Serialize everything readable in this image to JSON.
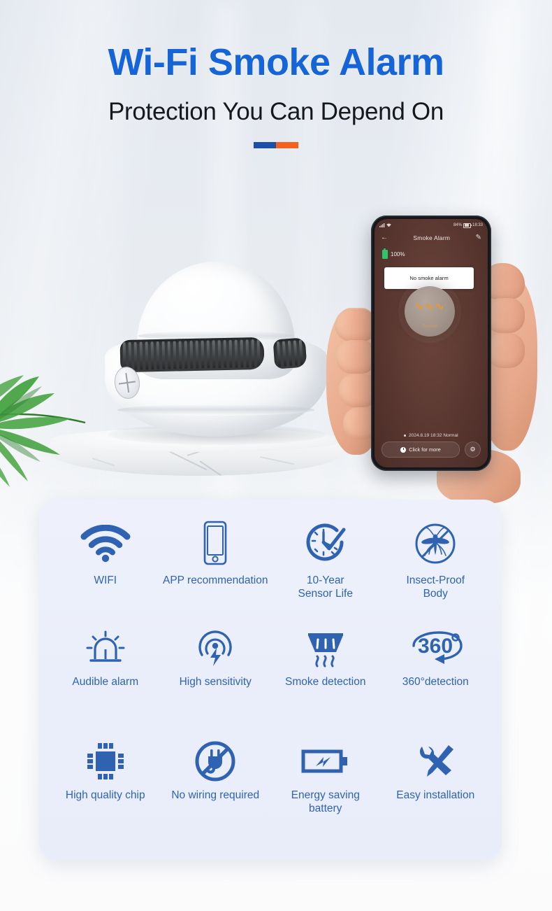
{
  "header": {
    "title": "Wi-Fi Smoke Alarm",
    "subtitle": "Protection You Can Depend On",
    "title_color": "#1565d8",
    "subtitle_color": "#16191c",
    "divider_left_color": "#1c4fa8",
    "divider_right_color": "#f4601e"
  },
  "phone": {
    "status_bar": {
      "battery_percent": "84%",
      "time": "18:33"
    },
    "app_bar": {
      "back_icon": "back-arrow-icon",
      "title": "Smoke Alarm",
      "edit_icon": "edit-pencil-icon"
    },
    "device_battery": "100%",
    "status_bubble": "No smoke alarm",
    "device_label": "Smoke",
    "log_line": "2024.8.19 18:32 Normal",
    "more_button": "Click for more",
    "settings_icon": "gear-icon",
    "screen_bg_color": "#5d3a33",
    "accent_color": "#e09a3c"
  },
  "features": {
    "accent_color": "#2f63b2",
    "panel_bg": "#eaeefa",
    "rows": [
      [
        {
          "icon": "wifi-icon",
          "label": "WIFI"
        },
        {
          "icon": "smartphone-icon",
          "label": "APP recommendation"
        },
        {
          "icon": "clock-check-icon",
          "label": "10-Year\nSensor Life"
        },
        {
          "icon": "mosquito-blocked-icon",
          "label": "Insect-Proof\nBody"
        }
      ],
      [
        {
          "icon": "siren-alarm-icon",
          "label": "Audible alarm"
        },
        {
          "icon": "signal-bolt-icon",
          "label": "High sensitivity"
        },
        {
          "icon": "smoke-detector-icon",
          "label": "Smoke detection"
        },
        {
          "icon": "360-rotation-icon",
          "label": "360°detection"
        }
      ],
      [
        {
          "icon": "chip-icon",
          "label": "High quality chip"
        },
        {
          "icon": "no-plug-icon",
          "label": "No wiring required"
        },
        {
          "icon": "battery-bolt-icon",
          "label": "Energy saving\nbattery"
        },
        {
          "icon": "wrench-screwdriver-icon",
          "label": "Easy installation"
        }
      ]
    ]
  }
}
